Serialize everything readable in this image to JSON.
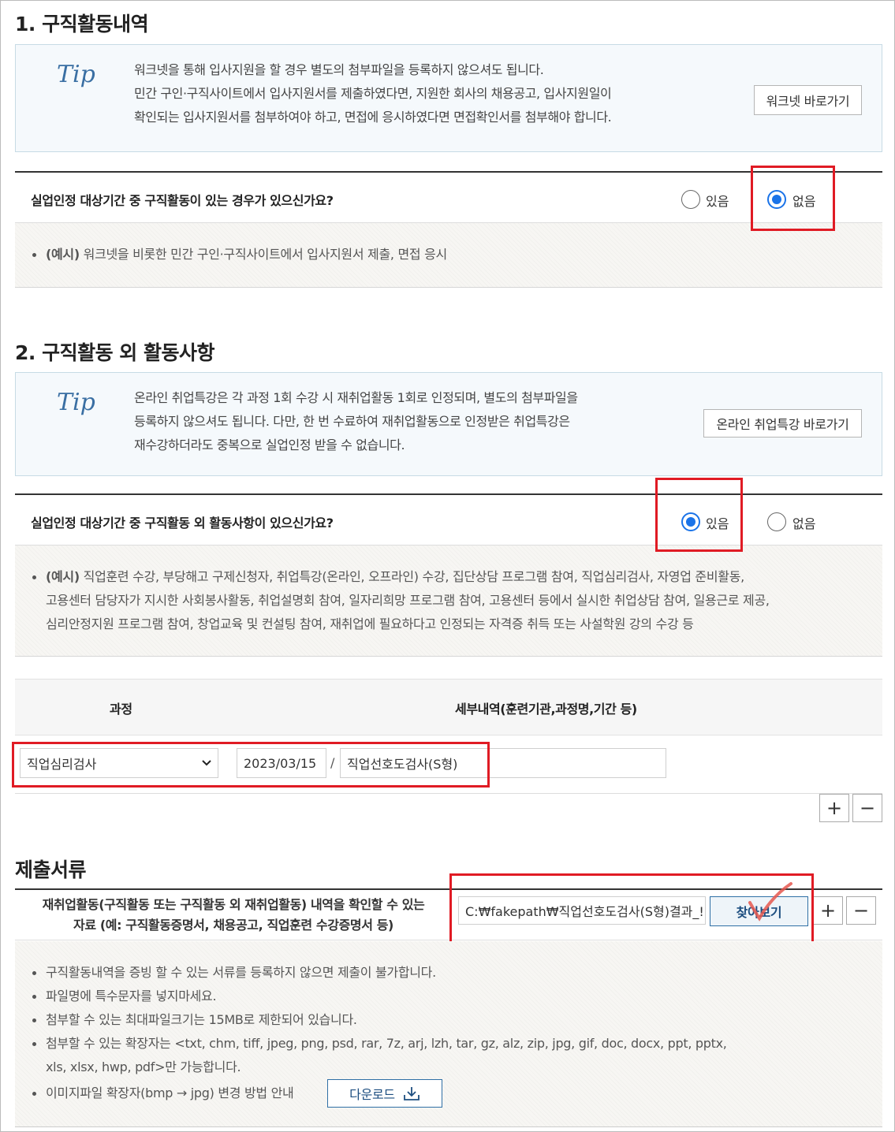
{
  "section1": {
    "title": "1. 구직활동내역",
    "tip_logo": "Tip",
    "tip_lines": [
      "워크넷을 통해 입사지원을 할 경우 별도의 첨부파일을 등록하지 않으셔도 됩니다.",
      "민간 구인·구직사이트에서 입사지원서를 제출하였다면, 지원한 회사의 채용공고, 입사지원일이",
      "확인되는 입사지원서를 첨부하여야 하고, 면접에 응시하였다면 면접확인서를 첨부해야 합니다."
    ],
    "link_button": "워크넷 바로가기",
    "question": "실업인정 대상기간 중 구직활동이 있는 경우가 있으신가요?",
    "option_yes": "있음",
    "option_no": "없음",
    "selected": "없음",
    "example_prefix": "(예시)",
    "example_text": " 워크넷을 비롯한 민간 구인·구직사이트에서 입사지원서 제출, 면접 응시"
  },
  "section2": {
    "title": "2. 구직활동 외 활동사항",
    "tip_logo": "Tip",
    "tip_lines": [
      "온라인 취업특강은 각 과정 1회 수강 시 재취업활동 1회로 인정되며, 별도의 첨부파일을",
      "등록하지 않으셔도 됩니다. 다만, 한 번 수료하여 재취업활동으로 인정받은 취업특강은",
      "재수강하더라도 중복으로 실업인정 받을 수 없습니다."
    ],
    "link_button": "온라인 취업특강 바로가기",
    "question": "실업인정 대상기간 중 구직활동 외 활동사항이 있으신가요?",
    "option_yes": "있음",
    "option_no": "없음",
    "selected": "있음",
    "example_prefix": "(예시)",
    "example_lines": [
      " 직업훈련 수강, 부당해고 구제신청자, 취업특강(온라인, 오프라인) 수강, 집단상담 프로그램 참여, 직업심리검사, 자영업 준비활동,",
      "고용센터 담당자가 지시한 사회봉사활동, 취업설명회 참여, 일자리희망 프로그램 참여, 고용센터 등에서 실시한 취업상담 참여, 일용근로 제공,",
      "심리안정지원 프로그램 참여, 창업교육 및 컨설팅 참여, 재취업에 필요하다고 인정되는 자격증 취득 또는 사설학원 강의 수강 등"
    ],
    "table": {
      "col_course": "과정",
      "col_detail": "세부내역(훈련기관,과정명,기간 등)",
      "course_value": "직업심리검사",
      "date_value": "2023/03/15",
      "separator": "/",
      "detail_value": "직업선호도검사(S형)"
    },
    "plus": "+",
    "minus": "−"
  },
  "section3": {
    "title": "제출서류",
    "label_line1": "재취업활동(구직활동 또는 구직활동 외 재취업활동) 내역을 확인할 수 있는",
    "label_line2": "자료 (예: 구직활동증명서, 채용공고, 직업훈련 수강증명서 등)",
    "file_value": "C:₩fakepath₩직업선호도검사(S형)결과_!",
    "browse_button": "찾아보기",
    "plus": "+",
    "minus": "−",
    "notes": [
      "구직활동내역을 증빙 할 수 있는 서류를 등록하지 않으면 제출이 불가합니다.",
      "파일명에 특수문자를 넣지마세요.",
      "첨부할 수 있는 최대파일크기는 15MB로 제한되어 있습니다.",
      "첨부할 수 있는 확장자는 <txt, chm, tiff, jpeg, png, psd, rar, 7z, arj, lzh, tar, gz, alz, zip, jpg, gif, doc, docx, ppt, pptx,"
    ],
    "notes_cont": "xls, xlsx, hwp, pdf>만 가능합니다.",
    "note_last": "이미지파일 확장자(bmp → jpg) 변경 방법 안내",
    "download_button": "다운로드"
  },
  "colors": {
    "accent": "#1a73e8",
    "highlight": "#e01b24"
  }
}
